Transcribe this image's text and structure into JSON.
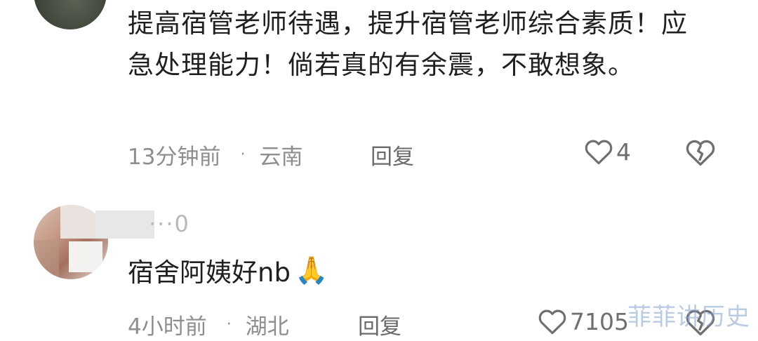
{
  "comments": [
    {
      "text": "提高宿管老师待遇，提升宿管老师综合素质！应急处理能力！倘若真的有余震，不敢想象。",
      "time": "13分钟前",
      "separator": "·",
      "location": "云南",
      "reply_label": "回复",
      "like_count": "4",
      "like_icon": "heart-outline-icon",
      "dislike_icon": "broken-heart-icon"
    },
    {
      "username": "···0",
      "text": "宿舍阿姨好nb",
      "emoji": "🙏",
      "time": "4小时前",
      "separator": "·",
      "location": "湖北",
      "reply_label": "回复",
      "like_count": "7105",
      "like_icon": "heart-outline-icon",
      "dislike_icon": "broken-heart-icon"
    }
  ],
  "watermark": "菲菲讲历史",
  "colors": {
    "text": "#1f1f1f",
    "meta": "#8e8e8e",
    "icon": "#6f6f6f",
    "watermark": "#82a0d2"
  }
}
